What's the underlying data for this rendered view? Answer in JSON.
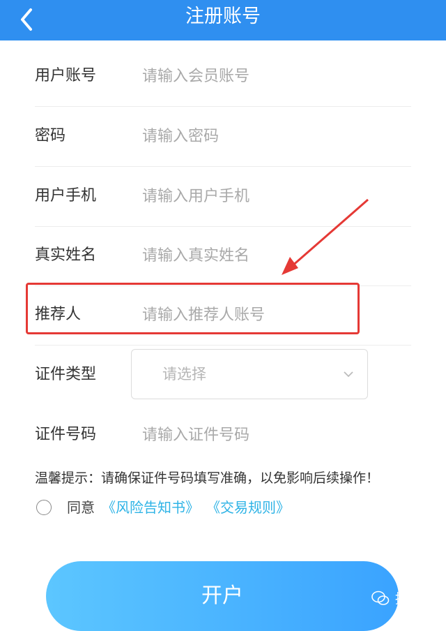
{
  "header": {
    "title": "注册账号",
    "back_icon": "chevron-left-icon",
    "background": "#2f8ff0"
  },
  "form": {
    "account": {
      "label": "用户账号",
      "placeholder": "请输入会员账号"
    },
    "password": {
      "label": "密码",
      "placeholder": "请输入密码"
    },
    "phone": {
      "label": "用户手机",
      "placeholder": "请输入用户手机"
    },
    "real_name": {
      "label": "真实姓名",
      "placeholder": "请输入真实姓名"
    },
    "referrer": {
      "label": "推荐人",
      "placeholder": "请输入推荐人账号"
    },
    "id_type": {
      "label": "证件类型",
      "placeholder": "请选择"
    },
    "id_number": {
      "label": "证件号码",
      "placeholder": "请输入证件号码"
    }
  },
  "tip": "温馨提示：请确保证件号码填写准确，以免影响后续操作！",
  "agreement": {
    "label": "同意",
    "link1": "《风险告知书》",
    "link2": "《交易规则》",
    "link_color": "#2eb3e6"
  },
  "submit_label": "开户",
  "watermark": "提销师",
  "annotation_color": "#e53935"
}
